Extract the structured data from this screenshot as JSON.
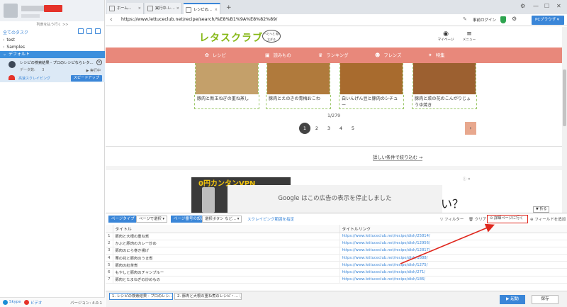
{
  "left": {
    "collapse": "列表を払う行く >>",
    "task_header": "全てのタスク",
    "tree": [
      {
        "label": "test"
      },
      {
        "label": "Samples"
      },
      {
        "label": "デフォルト"
      }
    ],
    "task": {
      "name": "レシピの検索結果 - プロのレシピならレタ…",
      "data_label": "データ数:",
      "data_count": "3",
      "status": "▶ 実行中",
      "speed_label": "高速スクレイピング",
      "speed_button": "スピードアップ"
    },
    "footer": {
      "skype": "Skype",
      "video": "ビデオ",
      "version": "バージョン: 4.0.1"
    }
  },
  "tabs": [
    {
      "label": "ホーム…"
    },
    {
      "label": "実行中-レ…"
    },
    {
      "label": "レシピの…"
    }
  ],
  "address": {
    "url": "https://www.lettuceclub.net/recipe/search/%E8%B1%9A%E8%82%89/",
    "prelogin": "事前ログイン",
    "browser": "PCブラウザ ▾"
  },
  "site": {
    "logo": "レタスクラブ",
    "bubble": "へとへと 献立ぎる",
    "mypage": "マイページ",
    "menu": "メニュー",
    "nav": [
      {
        "icon": "recipe-icon",
        "label": "レシピ"
      },
      {
        "icon": "read-icon",
        "label": "読みもの"
      },
      {
        "icon": "ranking-icon",
        "label": "ランキング"
      },
      {
        "icon": "friends-icon",
        "label": "フレンズ"
      },
      {
        "icon": "feature-icon",
        "label": "特集"
      }
    ],
    "cards": [
      {
        "title": "豚肉と新玉ねぎの重ね蒸し",
        "color": "#c4a06a"
      },
      {
        "title": "豚肉とえのきの青梅おこわ",
        "color": "#b07a3c"
      },
      {
        "title": "白いんげん豆と豚肉のシチュー",
        "color": "#a86b2e"
      },
      {
        "title": "豚肉と菜の花のこんがりじょうゆ焼き",
        "color": "#9c6030"
      }
    ],
    "page_count": "1/279",
    "pages": [
      "1",
      "2",
      "3",
      "4",
      "5"
    ],
    "next": "›",
    "detail_link": "詳しい条件で絞り込む →",
    "ad_text": "0円カンタンVPN",
    "ad_badge": "ⓘ ✕",
    "ad_question": "い？",
    "stopped": "Google はこの広告の表示を停止しました",
    "fold": "▼ 折る"
  },
  "panel": {
    "page_type_label": "ページタイプ",
    "page_type_value": "ページで選択 ▾",
    "page_num_label": "ページ番号の設定",
    "page_num_value": "選択ボタン など… ▾",
    "scrape_link": "スクレイピング範囲を指定",
    "filter": "▽ フィルター",
    "clear": "🗑 クリア",
    "detail_btn": "⊙ 詳細ページに行く",
    "add_field": "⊕ フィールドを追加",
    "columns": [
      "",
      "タイトル",
      "タイトルリンク"
    ],
    "rows": [
      [
        "1",
        "豚肉と大根の重ね煮",
        "https://www.lettuceclub.net/recipe/dish/25814/"
      ],
      [
        "2",
        "かぶと豚肉のカレー炒め",
        "https://www.lettuceclub.net/recipe/dish/12956/"
      ],
      [
        "3",
        "豚肉のにら巻き揚げ",
        "https://www.lettuceclub.net/recipe/dish/12817/"
      ],
      [
        "4",
        "栗の花と豚肉のうま煮",
        "https://www.lettuceclub.net/recipe/dish/1888/"
      ],
      [
        "5",
        "豚肉の紅茶煮",
        "https://www.lettuceclub.net/recipe/dish/1275/"
      ],
      [
        "6",
        "もやしと豚肉のチャンプルー",
        "https://www.lettuceclub.net/recipe/dish/271/"
      ],
      [
        "7",
        "豚肉とたまねぎの炒めもの",
        "https://www.lettuceclub.net/recipe/dish/186/"
      ]
    ]
  },
  "bottom": {
    "tab1": "1. レシピの検索結果 - プロのレシ…",
    "tab2": "2. 豚肉と大根の重ね煮のレシピ・… ⓘ",
    "run": "▶ 起動",
    "save": "保存"
  },
  "colors": {
    "accent": "#3a86d8",
    "nav": "#e8887b",
    "alert": "#e0281e"
  }
}
